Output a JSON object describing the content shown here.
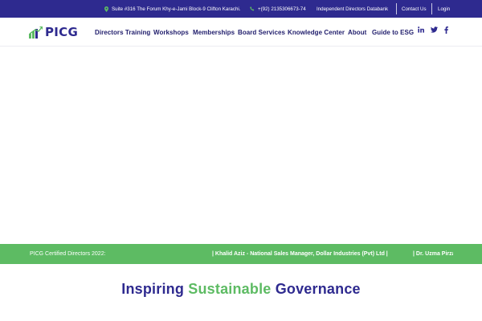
{
  "colors": {
    "topbar_bg": "#2e2a8f",
    "brand_navy": "#23206e",
    "brand_green": "#5dbb63",
    "ticker_bg": "#5dbb63"
  },
  "topbar": {
    "address_icon": "map-pin-icon",
    "address": "Suite #316 The Forum Khy-e-Jami Block-9 Clifton Karachi.",
    "phone_icon": "phone-icon",
    "phone": "+(92) 2135306673-74",
    "databank_link": "Independent Directors Databank",
    "contact_link": "Contact Us",
    "login_link": "Login"
  },
  "header": {
    "logo_text": "PICG",
    "nav": [
      {
        "label": "Directors Training"
      },
      {
        "label": "Workshops"
      },
      {
        "label": "Memberships"
      },
      {
        "label": "Board Services"
      },
      {
        "label": "Knowledge Center"
      },
      {
        "label": "About"
      },
      {
        "label": "Guide to ESG"
      }
    ],
    "social": [
      "linkedin-icon",
      "twitter-icon",
      "facebook-icon"
    ]
  },
  "ticker": {
    "label": "PICG Certified Directors 2022:",
    "items": [
      "| Khalid Aziz - National Sales Manager, Dollar Industries (Pvt) Ltd |",
      "| Dr. Uzma Pirzada"
    ]
  },
  "heading": {
    "part1": "Inspiring",
    "accent": "Sustainable",
    "part2": "Governance"
  }
}
